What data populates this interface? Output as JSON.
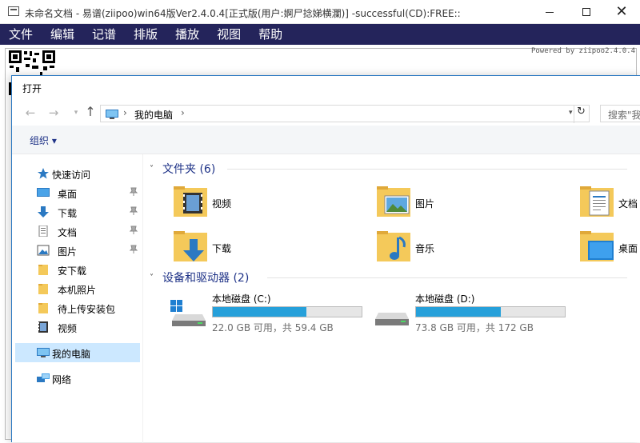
{
  "app": {
    "title": "未命名文档 - 易谱(ziipoo)win64版Ver2.4.0.4[正式版(用户:婀尸捻娣横瀾)] -successful(CD):FREE::",
    "menu": [
      "文件",
      "编辑",
      "记谱",
      "排版",
      "播放",
      "视图",
      "帮助"
    ],
    "powered_by": "Powered by ziipoo2.4.0.4"
  },
  "dialog": {
    "title": "打开",
    "address": "我的电脑",
    "search_placeholder": "搜索\"我的电脑\"",
    "organize_label": "组织 ▾",
    "sidebar": {
      "quick_access": "快速访问",
      "items": [
        {
          "label": "桌面",
          "icon": "desktop-icon",
          "pinned": true
        },
        {
          "label": "下载",
          "icon": "download-icon",
          "pinned": true
        },
        {
          "label": "文档",
          "icon": "document-icon",
          "pinned": true
        },
        {
          "label": "图片",
          "icon": "picture-icon",
          "pinned": true
        },
        {
          "label": "安下载",
          "icon": "folder-icon",
          "pinned": false
        },
        {
          "label": "本机照片",
          "icon": "folder-icon",
          "pinned": false
        },
        {
          "label": "待上传安装包",
          "icon": "folder-icon",
          "pinned": false
        },
        {
          "label": "视频",
          "icon": "video-icon",
          "pinned": false
        }
      ],
      "this_pc": "我的电脑",
      "network": "网络"
    },
    "folders_header": "文件夹 (6)",
    "folders": [
      {
        "name": "视频",
        "icon": "video-folder-icon"
      },
      {
        "name": "图片",
        "icon": "pictures-folder-icon"
      },
      {
        "name": "文档",
        "icon": "documents-folder-icon"
      },
      {
        "name": "下载",
        "icon": "downloads-folder-icon"
      },
      {
        "name": "音乐",
        "icon": "music-folder-icon"
      },
      {
        "name": "桌面",
        "icon": "desktop-folder-icon"
      }
    ],
    "drives_header": "设备和驱动器 (2)",
    "drives": [
      {
        "name": "本地磁盘 (C:)",
        "space": "22.0 GB 可用，共 59.4 GB",
        "used_fraction": 0.63,
        "icon": "windows-drive-icon"
      },
      {
        "name": "本地磁盘 (D:)",
        "space": "73.8 GB 可用，共 172 GB",
        "used_fraction": 0.57,
        "icon": "hard-drive-icon"
      }
    ]
  },
  "colors": {
    "menubar": "#24245b",
    "accent": "#1e3287",
    "drive_fill": "#26a0da",
    "selection": "#cce8ff",
    "folder_yellow": "#f4c95a"
  }
}
